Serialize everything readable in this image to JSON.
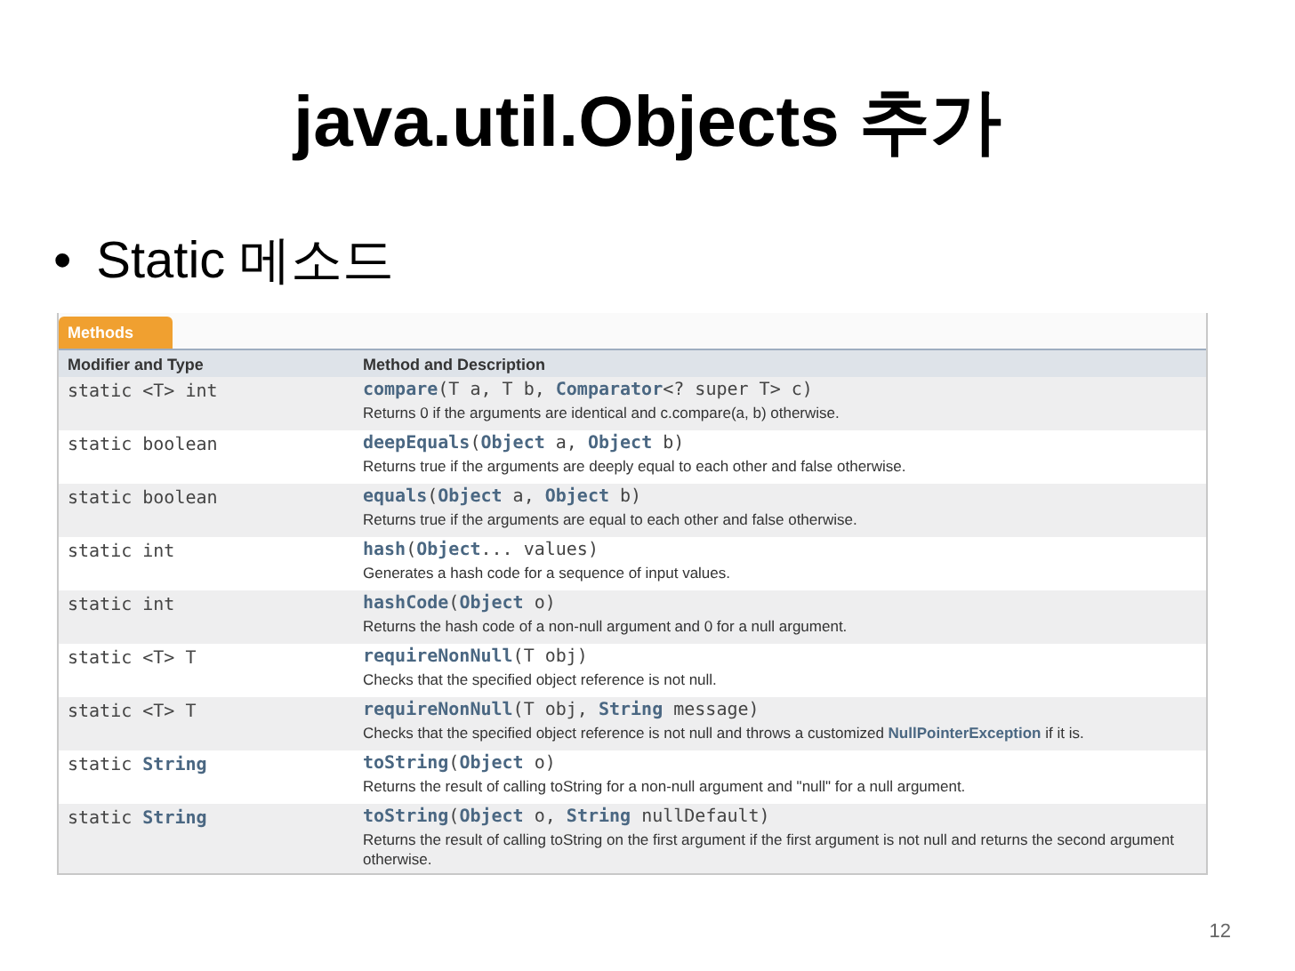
{
  "title": "java.util.Objects 추가",
  "bullet": {
    "marker": "•",
    "text": "Static 메소드"
  },
  "table": {
    "tab": "Methods",
    "columns": [
      "Modifier and Type",
      "Method and Description"
    ],
    "rows": [
      {
        "type": "static <T> int",
        "signature": "**compare**(T a, T b, **Comparator**<? super T> c)",
        "description": "Returns 0 if the arguments are identical and c.compare(a, b) otherwise."
      },
      {
        "type": "static boolean",
        "signature": "**deepEquals**(**Object** a, **Object** b)",
        "description": "Returns true if the arguments are deeply equal to each other and false otherwise."
      },
      {
        "type": "static boolean",
        "signature": "**equals**(**Object** a, **Object** b)",
        "description": "Returns true if the arguments are equal to each other and false otherwise."
      },
      {
        "type": "static int",
        "signature": "**hash**(**Object**... values)",
        "description": "Generates a hash code for a sequence of input values."
      },
      {
        "type": "static int",
        "signature": "**hashCode**(**Object** o)",
        "description": "Returns the hash code of a non-null argument and 0 for a null argument."
      },
      {
        "type": "static <T> T",
        "signature": "**requireNonNull**(T obj)",
        "description": "Checks that the specified object reference is not null."
      },
      {
        "type": "static <T> T",
        "signature": "**requireNonNull**(T obj, **String** message)",
        "description": "Checks that the specified object reference is not null and throws a customized **NullPointerException** if it is."
      },
      {
        "type": "static **String**",
        "signature": "**toString**(**Object** o)",
        "description": "Returns the result of calling toString for a non-null argument and \"null\" for a null argument."
      },
      {
        "type": "static **String**",
        "signature": "**toString**(**Object** o, **String** nullDefault)",
        "description": "Returns the result of calling toString on the first argument if the first argument is not null and returns the second argument otherwise."
      }
    ]
  },
  "page_number": "12"
}
